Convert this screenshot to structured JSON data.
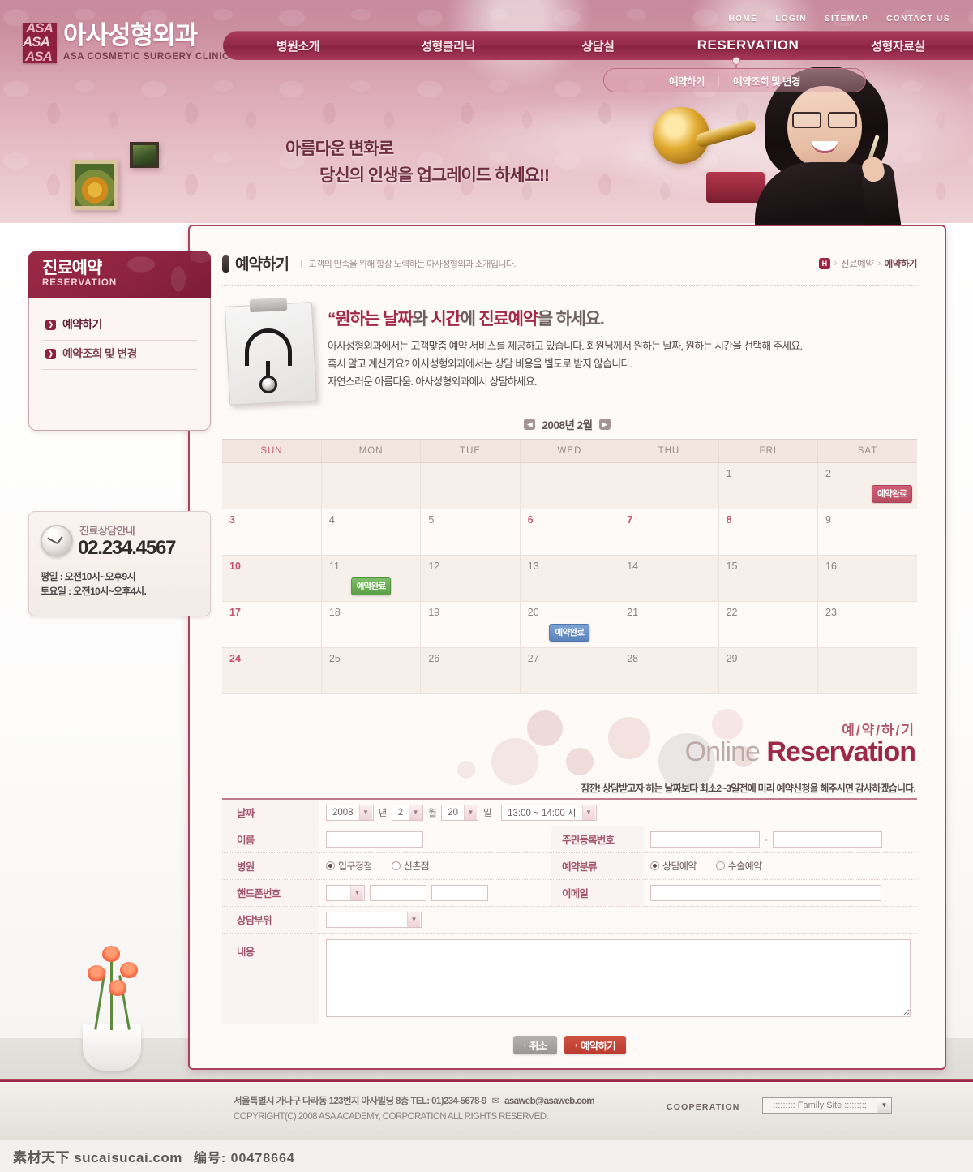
{
  "site": {
    "logo_ko": "아사성형외과",
    "logo_en": "ASA COSMETIC SURGERY CLINIC",
    "logo_mark": "ASA"
  },
  "utilnav": [
    {
      "label": "HOME"
    },
    {
      "label": "LOGIN"
    },
    {
      "label": "SITEMAP"
    },
    {
      "label": "CONTACT US"
    }
  ],
  "mainnav": [
    {
      "label": "병원소개",
      "active": false
    },
    {
      "label": "성형클리닉",
      "active": false
    },
    {
      "label": "상담실",
      "active": false
    },
    {
      "label": "RESERVATION",
      "active": true
    },
    {
      "label": "성형자료실",
      "active": false
    }
  ],
  "subnav": {
    "items": [
      {
        "label": "예약하기"
      },
      {
        "label": "예약조회 및 변경"
      }
    ],
    "separator": "|"
  },
  "hero": {
    "line1": "아름다운 변화로",
    "line2": "당신의 인생을 업그레이드 하세요!!"
  },
  "sidebar": {
    "title_ko": "진료예약",
    "title_en": "RESERVATION",
    "items": [
      {
        "label": "예약하기",
        "arrow": "chevron-right-icon",
        "current": true
      },
      {
        "label": "예약조회 및 변경",
        "arrow": "chevron-right-icon",
        "current": false
      }
    ]
  },
  "contact": {
    "heading": "진료상담안내",
    "phone": "02.234.4567",
    "hours_weekday": "평일 : 오전10시~오후9시",
    "hours_saturday": "토요일 : 오전10시~오후4시."
  },
  "page": {
    "title": "예약하기",
    "subtitle": "고객의 만족을 위해 항상 노력하는 아사성형외과 소개입니다."
  },
  "breadcrumb": {
    "home_icon": "H",
    "sep": "›",
    "level1": "진료예약",
    "current": "예약하기"
  },
  "intro": {
    "title_quote": "“원하는 날짜",
    "title_mid": "와 ",
    "title_quote2": "시간",
    "title_mid2": "에 ",
    "title_quote3": "진료예약",
    "title_tail": "을 하세요.",
    "para1": "아사성형외과에서는 고객맞춤 예약 서비스를 제공하고 있습니다. 회원님께서 원하는 날짜, 원하는 시간을 선택해 주세요.",
    "para2": "혹시 알고 계신가요? 아사성형외과에서는 상담 비용을 별도로 받지 않습니다.",
    "para3": "자연스러운 아름다움. 아사성형외과에서 상담하세요."
  },
  "calendar": {
    "prev_icon": "◀",
    "next_icon": "▶",
    "label": "2008년 2월",
    "weekdays": [
      "SUN",
      "MON",
      "TUE",
      "WED",
      "THU",
      "FRI",
      "SAT"
    ],
    "badge_label": "예약완료",
    "weeks": [
      [
        {
          "day": ""
        },
        {
          "day": ""
        },
        {
          "day": ""
        },
        {
          "day": ""
        },
        {
          "day": ""
        },
        {
          "day": "1"
        },
        {
          "day": "2",
          "badge": "red"
        }
      ],
      [
        {
          "day": "3",
          "holiday": true
        },
        {
          "day": "4"
        },
        {
          "day": "5"
        },
        {
          "day": "6",
          "holiday": true
        },
        {
          "day": "7",
          "holiday": true
        },
        {
          "day": "8",
          "holiday": true
        },
        {
          "day": "9"
        }
      ],
      [
        {
          "day": "10"
        },
        {
          "day": "11",
          "badge": "green"
        },
        {
          "day": "12"
        },
        {
          "day": "13"
        },
        {
          "day": "14"
        },
        {
          "day": "15"
        },
        {
          "day": "16"
        }
      ],
      [
        {
          "day": "17",
          "holiday": true
        },
        {
          "day": "18"
        },
        {
          "day": "19"
        },
        {
          "day": "20",
          "badge": "blue"
        },
        {
          "day": "21"
        },
        {
          "day": "22"
        },
        {
          "day": "23"
        }
      ],
      [
        {
          "day": "24",
          "holiday": true
        },
        {
          "day": "25"
        },
        {
          "day": "26"
        },
        {
          "day": "27"
        },
        {
          "day": "28"
        },
        {
          "day": "29"
        },
        {
          "day": ""
        }
      ]
    ]
  },
  "online_banner": {
    "ko": "예/약/하/기",
    "en_light": "Online ",
    "en_dark": "Reservation",
    "note": "잠깐! 상담받고자 하는 날짜보다 최소2~3일전에 미리 예약신청을 해주시면 감사하겠습니다."
  },
  "form": {
    "date": {
      "label": "날짜",
      "year_value": "2008",
      "year_unit": "년",
      "month_value": "2",
      "month_unit": "월",
      "day_value": "20",
      "day_unit": "일",
      "time_value": "13:00 ~ 14:00 시"
    },
    "name": {
      "label": "이름",
      "value": "",
      "placeholder": ""
    },
    "ssn": {
      "label": "주민등록번호",
      "value1": "",
      "value2": "",
      "separator": "-"
    },
    "hospital": {
      "label": "병원",
      "options": [
        {
          "label": "입구정점",
          "selected": true
        },
        {
          "label": "신촌점",
          "selected": false
        }
      ]
    },
    "category": {
      "label": "예약분류",
      "options": [
        {
          "label": "상담예약",
          "selected": true
        },
        {
          "label": "수술예약",
          "selected": false
        }
      ]
    },
    "mobile": {
      "label": "핸드폰번호",
      "prefix": "",
      "value1": "",
      "value2": ""
    },
    "email": {
      "label": "이메일",
      "value": ""
    },
    "area": {
      "label": "상담부위",
      "value": ""
    },
    "content": {
      "label": "내용",
      "value": ""
    },
    "buttons": {
      "cancel": "취소",
      "submit": "예약하기",
      "caret": "›"
    }
  },
  "footer": {
    "address": "서울특별시 가나구 다라동 123번지 아사빌딩 8층 TEL: 01)234-5678-9",
    "mail_icon": "envelope-icon",
    "email": "asaweb@asaweb.com",
    "copyright": "COPYRIGHT(C) 2008 ASA ACADEMY, CORPORATION ALL RIGHTS RESERVED.",
    "cooperation": "COOPERATION",
    "family_site": "::::::::: Family Site :::::::::",
    "family_caret": "▼"
  },
  "watermark": {
    "text1": "素材天下 sucaisucai.com",
    "text2": "编号: 00478664"
  }
}
